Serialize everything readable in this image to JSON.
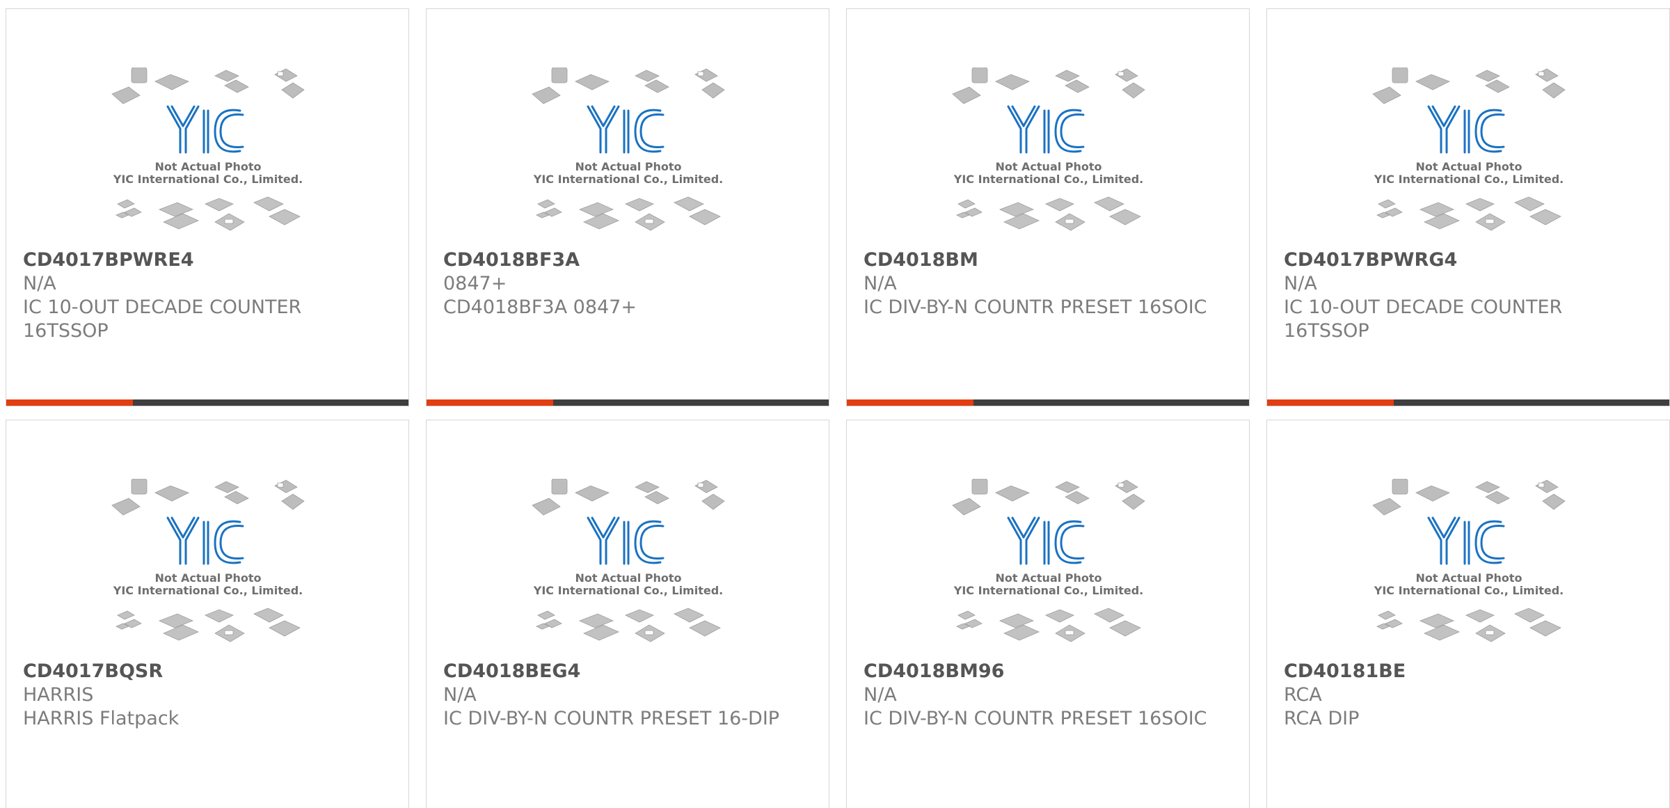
{
  "placeholder_image": {
    "caption_line1": "Not Actual Photo",
    "caption_line2": "YIC International Co., Limited.",
    "logo_text": "YIC",
    "logo_color": "#1a72c2",
    "chip_color": "#b9b9b9"
  },
  "accent_color": "#e33d12",
  "products": [
    {
      "part_number": "CD4017BPWRE4",
      "manufacturer": "N/A",
      "description": "IC 10-OUT DECADE COUNTER 16TSSOP"
    },
    {
      "part_number": "CD4018BF3A",
      "manufacturer": "0847+",
      "description": "CD4018BF3A 0847+"
    },
    {
      "part_number": "CD4018BM",
      "manufacturer": "N/A",
      "description": "IC DIV-BY-N COUNTR PRESET 16SOIC"
    },
    {
      "part_number": "CD4017BPWRG4",
      "manufacturer": "N/A",
      "description": "IC 10-OUT DECADE COUNTER 16TSSOP"
    },
    {
      "part_number": "CD4017BQSR",
      "manufacturer": "HARRIS",
      "description": "HARRIS Flatpack"
    },
    {
      "part_number": "CD4018BEG4",
      "manufacturer": "N/A",
      "description": "IC DIV-BY-N COUNTR PRESET 16-DIP"
    },
    {
      "part_number": "CD4018BM96",
      "manufacturer": "N/A",
      "description": "IC DIV-BY-N COUNTR PRESET 16SOIC"
    },
    {
      "part_number": "CD40181BE",
      "manufacturer": "RCA",
      "description": "RCA DIP"
    }
  ]
}
